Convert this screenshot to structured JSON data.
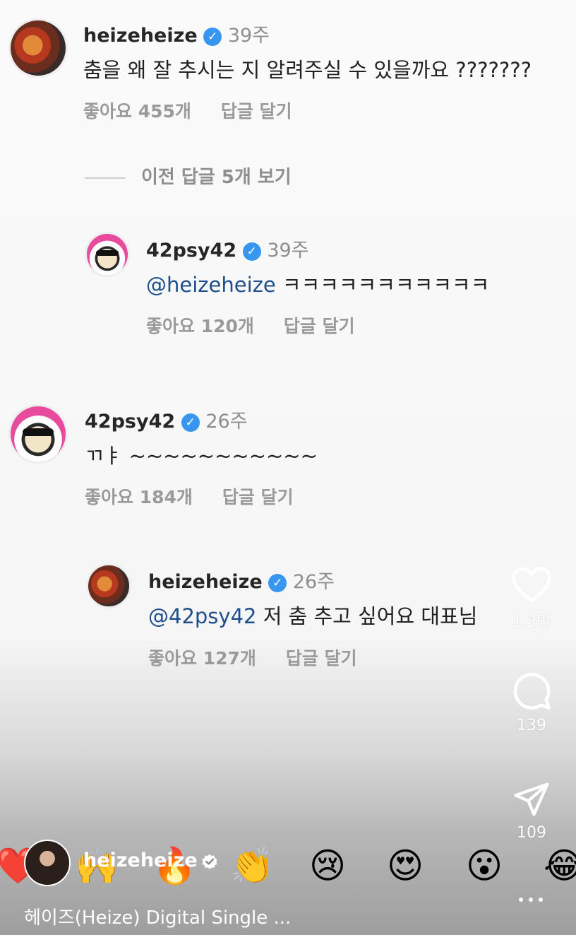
{
  "comments": [
    {
      "username": "heizeheize",
      "verified": true,
      "ago": "39주",
      "text": "춤을 왜 잘 추시는 지 알려주실 수 있을까요 ???????",
      "likes": "좋아요 455개",
      "reply": "답글 달기"
    },
    {
      "username": "42psy42",
      "verified": true,
      "ago": "39주",
      "mention": "@heizeheize",
      "text": " ㅋㅋㅋㅋㅋㅋㅋㅋㅋㅋㅋ",
      "likes": "좋아요 120개",
      "reply": "답글 달기"
    },
    {
      "username": "42psy42",
      "verified": true,
      "ago": "26주",
      "text": "ㄲㅑ ~~~~~~~~~~~",
      "likes": "좋아요 184개",
      "reply": "답글 달기"
    },
    {
      "username": "heizeheize",
      "verified": true,
      "ago": "26주",
      "mention": "@42psy42",
      "text": " 저 춤 추고 싶어요 대표님",
      "likes": "좋아요 127개",
      "reply": "답글 달기"
    }
  ],
  "view_previous": "이전 답글 5개 보기",
  "side_actions": {
    "like_count": "1.3만",
    "comment_count": "139",
    "share_count": "109"
  },
  "emojis": [
    "❤️",
    "🙌",
    "🔥",
    "👏",
    "😢",
    "😍",
    "😮",
    "😂"
  ],
  "author": {
    "username": "heizeheize",
    "verified": true
  },
  "caption": "헤이즈(Heize) Digital Single ...",
  "colors": {
    "verified": "#3797f0",
    "mention": "#1f4e8c"
  }
}
